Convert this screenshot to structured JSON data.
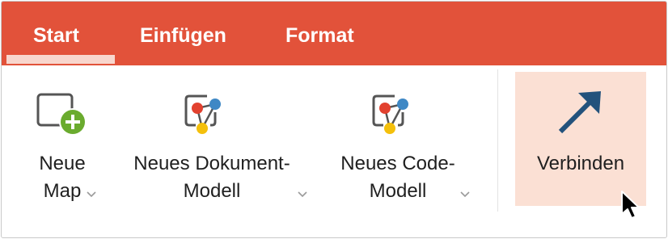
{
  "tabs": {
    "start": "Start",
    "insert": "Einfügen",
    "format": "Format"
  },
  "ribbon": {
    "new_map": {
      "line1": "Neue",
      "line2": "Map",
      "icon": "new-map-icon"
    },
    "new_document_model": {
      "line1": "Neues Dokument-",
      "line2": "Modell",
      "icon": "document-model-icon"
    },
    "new_code_model": {
      "line1": "Neues Code-",
      "line2": "Modell",
      "icon": "code-model-icon"
    },
    "connect": {
      "label": "Verbinden",
      "icon": "connect-arrow-icon"
    }
  },
  "colors": {
    "tab_bar": "#e2523a",
    "active_tab_underline": "#f8d6cd",
    "connect_highlight": "#fbe0d4",
    "plus_green": "#6aab2e",
    "node_red": "#e2412f",
    "node_blue": "#3f88c5",
    "node_yellow": "#f4c00c",
    "arrow_blue": "#23527c"
  }
}
